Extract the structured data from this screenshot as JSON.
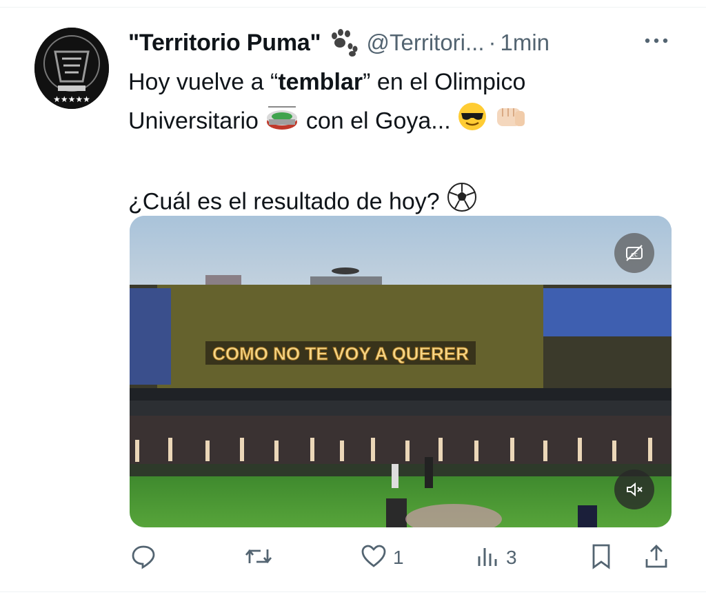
{
  "tweet": {
    "display_name": "\"Territorio Puma\"",
    "handle": "@Territori...",
    "separator": "·",
    "time": "1min",
    "text_line1_prefix": "Hoy vuelve a “",
    "text_line1_bold": "temblar",
    "text_line1_suffix": "” en el Olimpico",
    "text_line2_prefix": "Universitario",
    "text_line2_mid": "con el Goya...",
    "text_line3": "¿Cuál es el resultado de hoy?"
  },
  "media": {
    "banner_text": "COMO NO TE VOY A QUERER",
    "sky_color": "#a9c3da",
    "pitch_color": "#3f8a2e"
  },
  "actions": {
    "reply_count": "",
    "repost_count": "",
    "like_count": "1",
    "views_count": "3"
  },
  "icons": [
    "paw-icon",
    "more-icon",
    "stadium-emoji-icon",
    "sunglasses-emoji-icon",
    "fist-emoji-icon",
    "soccer-ball-icon",
    "closed-captions-icon",
    "mute-icon",
    "reply-icon",
    "repost-icon",
    "like-icon",
    "views-icon",
    "bookmark-icon",
    "share-icon"
  ]
}
